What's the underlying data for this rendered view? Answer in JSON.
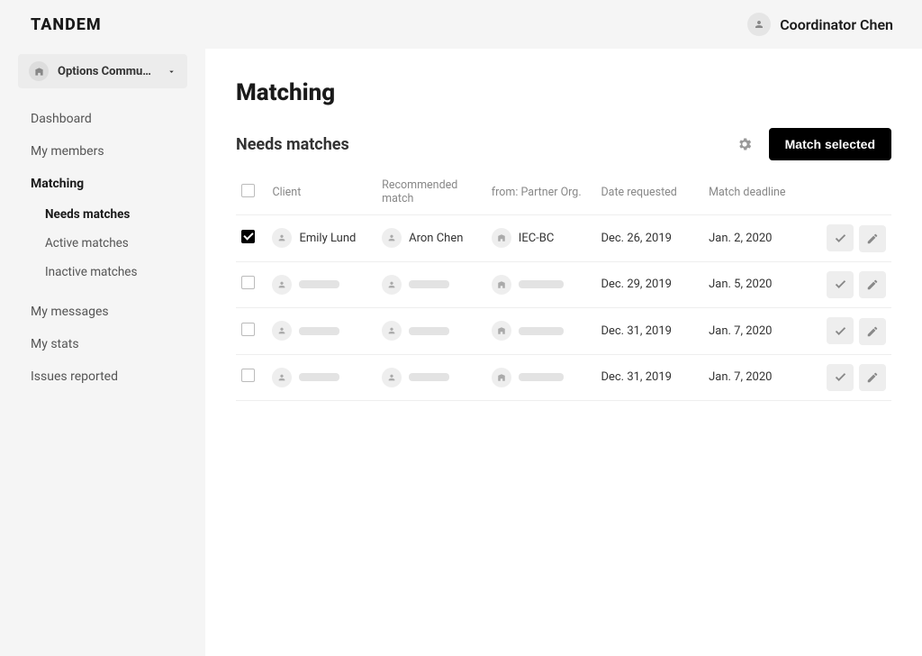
{
  "header": {
    "logo": "TANDEM",
    "user_name": "Coordinator Chen"
  },
  "sidebar": {
    "org_name": "Options Community...",
    "nav": {
      "dashboard": "Dashboard",
      "my_members": "My members",
      "matching": "Matching",
      "matching_sub": {
        "needs": "Needs matches",
        "active": "Active matches",
        "inactive": "Inactive matches"
      },
      "my_messages": "My messages",
      "my_stats": "My stats",
      "issues": "Issues reported"
    }
  },
  "main": {
    "page_title": "Matching",
    "section_title": "Needs matches",
    "match_button": "Match selected",
    "columns": {
      "client": "Client",
      "recommended": "Recommended match",
      "from_org": "from: Partner Org.",
      "date_requested": "Date requested",
      "deadline": "Match deadline"
    },
    "rows": [
      {
        "checked": true,
        "client": "Emily Lund",
        "recommended": "Aron Chen",
        "org": "IEC-BC",
        "date_requested": "Dec. 26, 2019",
        "deadline": "Jan. 2, 2020",
        "placeholder": false
      },
      {
        "checked": false,
        "date_requested": "Dec. 29, 2019",
        "deadline": "Jan. 5, 2020",
        "placeholder": true
      },
      {
        "checked": false,
        "date_requested": "Dec. 31, 2019",
        "deadline": "Jan. 7, 2020",
        "placeholder": true
      },
      {
        "checked": false,
        "date_requested": "Dec. 31, 2019",
        "deadline": "Jan. 7, 2020",
        "placeholder": true
      }
    ]
  }
}
